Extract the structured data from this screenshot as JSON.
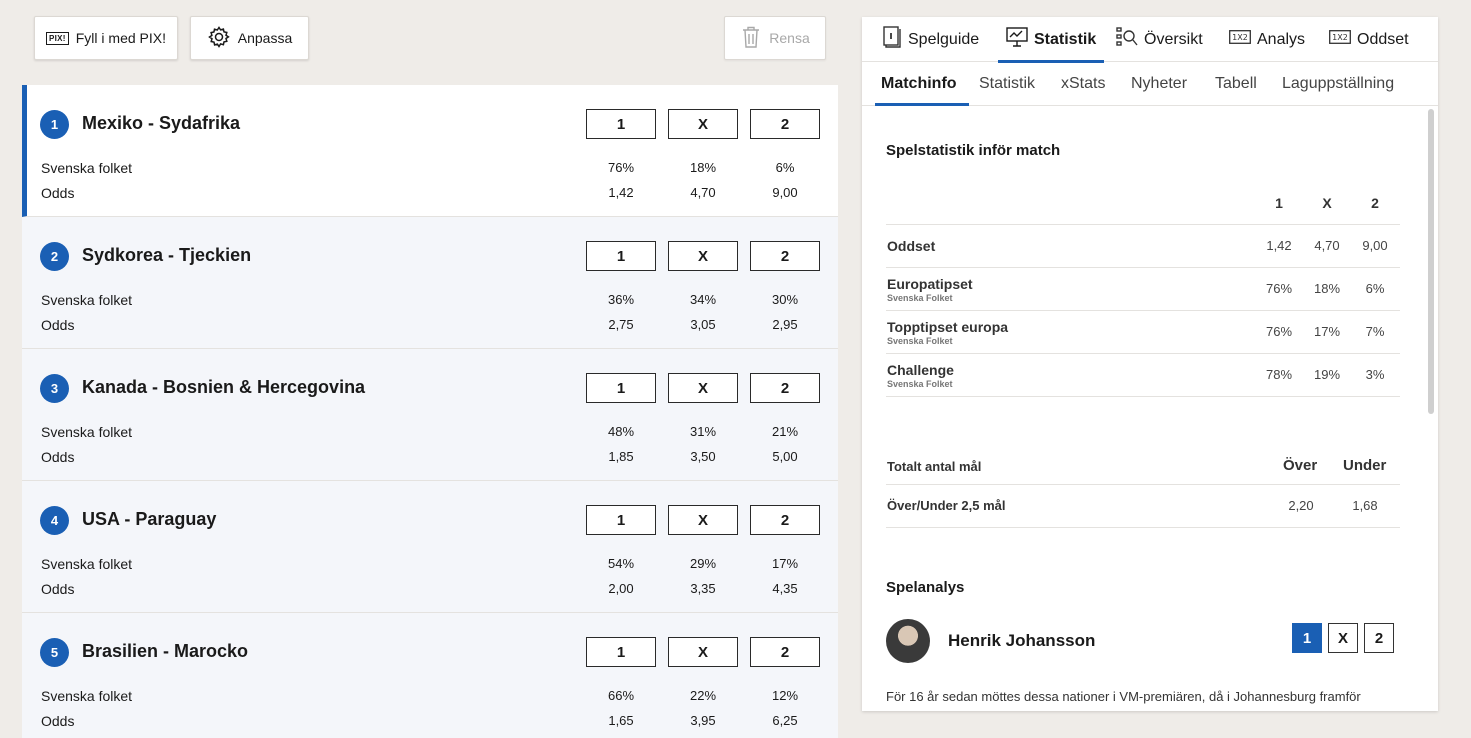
{
  "toolbar": {
    "pix_badge": "PIX!",
    "fill_pix_label": "Fyll i med PIX!",
    "customize_label": "Anpassa",
    "clear_label": "Rensa"
  },
  "matches": [
    {
      "num": "1",
      "teams": "Mexiko - Sydafrika",
      "people": [
        "76%",
        "18%",
        "6%"
      ],
      "odds": [
        "1,42",
        "4,70",
        "9,00"
      ]
    },
    {
      "num": "2",
      "teams": "Sydkorea - Tjeckien",
      "people": [
        "36%",
        "34%",
        "30%"
      ],
      "odds": [
        "2,75",
        "3,05",
        "2,95"
      ]
    },
    {
      "num": "3",
      "teams": "Kanada - Bosnien & Hercegovina",
      "people": [
        "48%",
        "31%",
        "21%"
      ],
      "odds": [
        "1,85",
        "3,50",
        "5,00"
      ]
    },
    {
      "num": "4",
      "teams": "USA - Paraguay",
      "people": [
        "54%",
        "29%",
        "17%"
      ],
      "odds": [
        "2,00",
        "3,35",
        "4,35"
      ]
    },
    {
      "num": "5",
      "teams": "Brasilien - Marocko",
      "people": [
        "66%",
        "22%",
        "12%"
      ],
      "odds": [
        "1,65",
        "3,95",
        "6,25"
      ]
    }
  ],
  "labels": {
    "people": "Svenska folket",
    "odds": "Odds",
    "pick_1": "1",
    "pick_x": "X",
    "pick_2": "2"
  },
  "panel": {
    "tabs": [
      "Spelguide",
      "Statistik",
      "Översikt",
      "Analys",
      "Oddset"
    ],
    "subtabs": [
      "Matchinfo",
      "Statistik",
      "xStats",
      "Nyheter",
      "Tabell",
      "Laguppställning"
    ],
    "stats_title": "Spelstatistik inför match",
    "stats_cols": [
      "1",
      "X",
      "2"
    ],
    "stats_rows": [
      {
        "name": "Oddset",
        "sub": "",
        "values": [
          "1,42",
          "4,70",
          "9,00"
        ]
      },
      {
        "name": "Europatipset",
        "sub": "Svenska Folket",
        "values": [
          "76%",
          "18%",
          "6%"
        ]
      },
      {
        "name": "Topptipset europa",
        "sub": "Svenska Folket",
        "values": [
          "76%",
          "17%",
          "7%"
        ]
      },
      {
        "name": "Challenge",
        "sub": "Svenska Folket",
        "values": [
          "78%",
          "19%",
          "3%"
        ]
      }
    ],
    "goals_title": "Totalt antal mål",
    "goals_cols": [
      "Över",
      "Under"
    ],
    "goals_row": {
      "name": "Över/Under 2,5 mål",
      "values": [
        "2,20",
        "1,68"
      ]
    },
    "analysis_title": "Spelanalys",
    "expert_name": "Henrik Johansson",
    "expert_picks": [
      "1",
      "X",
      "2"
    ],
    "analysis_text": "För 16 år sedan möttes dessa nationer i VM-premiären, då i Johannesburg framför"
  },
  "colors": {
    "accent": "#1a5fb4",
    "background": "#efece8"
  }
}
